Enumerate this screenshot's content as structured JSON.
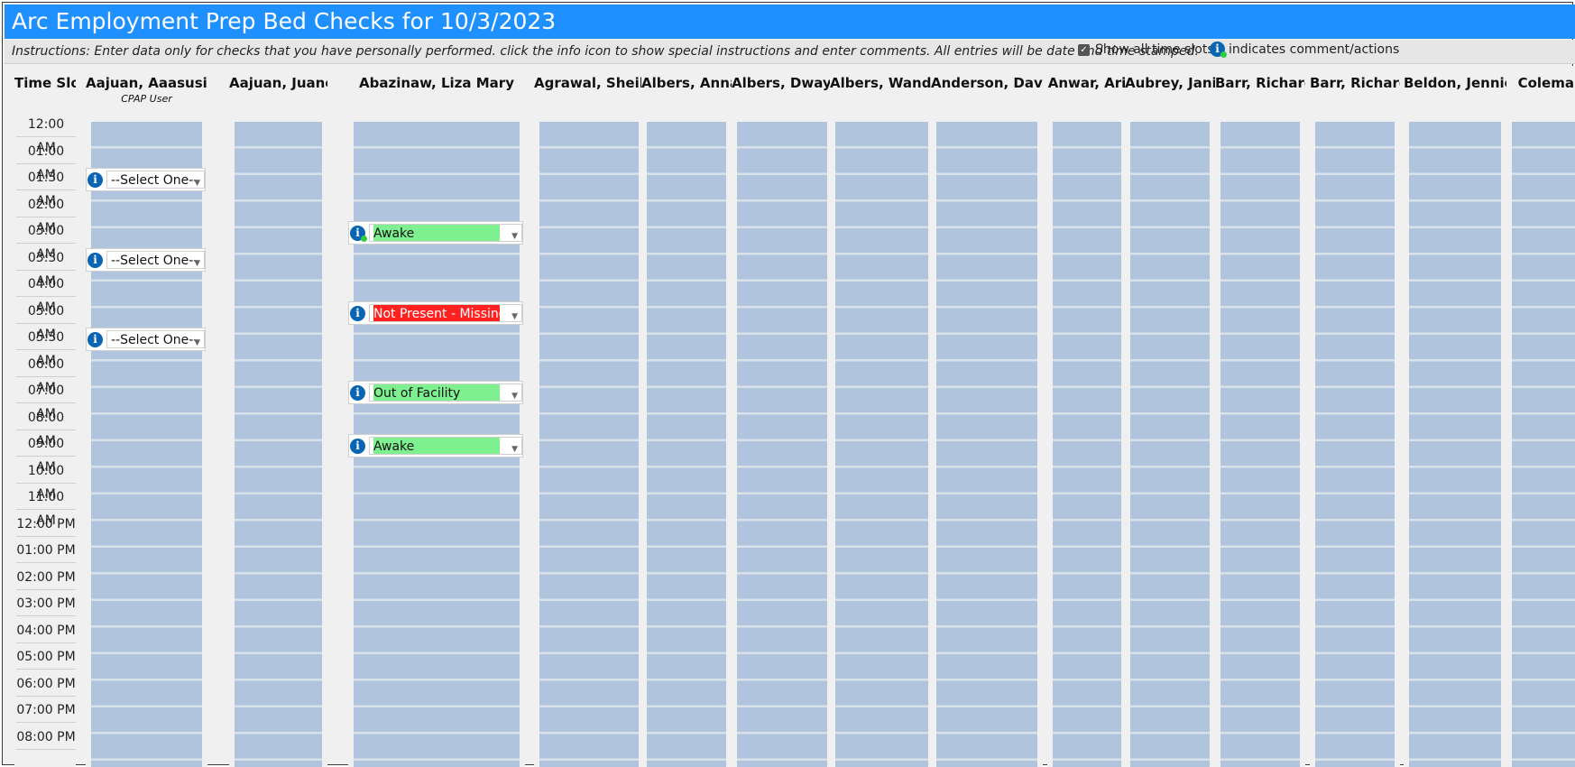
{
  "title": "Arc Employment Prep Bed Checks for 10/3/2023",
  "instructions": "Instructions: Enter data only for checks that you have personally performed. click the info icon to show special instructions and enter comments. All entries will be date and time stamped.",
  "show_all_label": "Show all time slots",
  "show_all_checked": true,
  "legend_text": "indicates comment/actions",
  "time_header": "Time Slot",
  "time_slots": [
    "12:00 AM",
    "01:00 AM",
    "01:30 AM",
    "02:00 AM",
    "03:00 AM",
    "03:30 AM",
    "04:00 AM",
    "05:00 AM",
    "05:30 AM",
    "06:00 AM",
    "07:00 AM",
    "08:00 AM",
    "09:00 AM",
    "10:00 AM",
    "11:00 AM",
    "12:00 PM",
    "01:00 PM",
    "02:00 PM",
    "03:00 PM",
    "04:00 PM",
    "05:00 PM",
    "06:00 PM",
    "07:00 PM",
    "08:00 PM"
  ],
  "colors": {
    "title_bar": "#1e90ff",
    "cell_fill": "#b0c4de",
    "status_green": "#7ef08f",
    "status_red": "#ff2020",
    "info_icon": "#0a64b4"
  },
  "residents": [
    {
      "name": "Aajuan, Aaasusie",
      "subtitle": "CPAP User",
      "checks": [
        {
          "slot": "01:30 AM",
          "value": "--Select One--",
          "status": "none",
          "has_comment": false
        },
        {
          "slot": "03:30 AM",
          "value": "--Select One--",
          "status": "none",
          "has_comment": false
        },
        {
          "slot": "05:30 AM",
          "value": "--Select One--",
          "status": "none",
          "has_comment": false
        }
      ]
    },
    {
      "name": "Aajuan, Juané A",
      "checks": []
    },
    {
      "name": "Abazinaw, Liza Mary",
      "checks": [
        {
          "slot": "03:00 AM",
          "value": "Awake",
          "status": "green",
          "has_comment": true
        },
        {
          "slot": "05:00 AM",
          "value": "Not Present - Missing",
          "status": "red",
          "has_comment": false
        },
        {
          "slot": "07:00 AM",
          "value": "Out of Facility",
          "status": "green",
          "has_comment": false
        },
        {
          "slot": "09:00 AM",
          "value": "Awake",
          "status": "green",
          "has_comment": false
        }
      ]
    },
    {
      "name": "Agrawal, Sheila",
      "checks": []
    },
    {
      "name": "Albers, Anna",
      "checks": []
    },
    {
      "name": "Albers, Dwayne",
      "checks": []
    },
    {
      "name": "Albers, Wanda",
      "checks": []
    },
    {
      "name": "Anderson, Davis",
      "checks": []
    },
    {
      "name": "Anwar, Ari",
      "checks": []
    },
    {
      "name": "Aubrey, Janie",
      "checks": []
    },
    {
      "name": "Barr, Richard",
      "checks": []
    },
    {
      "name": "Barr, Richard",
      "checks": []
    },
    {
      "name": "Beldon, Jennie",
      "checks": []
    },
    {
      "name": "Coleman, S",
      "checks": []
    }
  ]
}
